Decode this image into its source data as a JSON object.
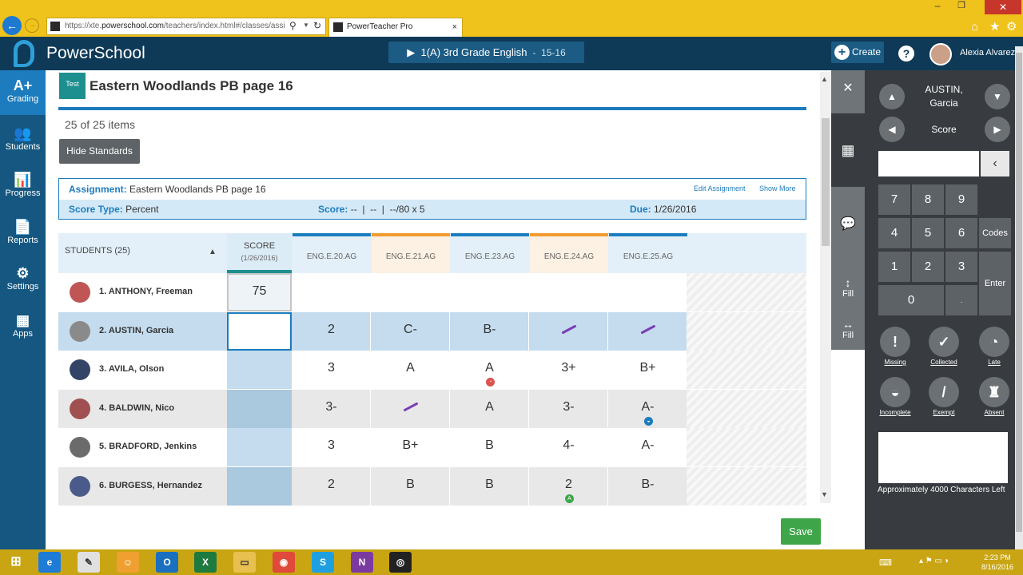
{
  "browser": {
    "url_prefix": "https://xte.",
    "url_domain": "powerschool.com",
    "url_path": "/teachers/index.html#/classes/assi",
    "tab_title": "PowerTeacher Pro",
    "tab_close": "×",
    "win_min": "–",
    "win_max": "❐",
    "win_close": "✕"
  },
  "header": {
    "brand": "PowerSchool",
    "class_name": "1(A) 3rd Grade English",
    "term": "15-16",
    "create_label": "Create",
    "help_label": "?",
    "user_name": "Alexia Alvarez"
  },
  "nav": [
    {
      "label": "Grading",
      "icon": "A+"
    },
    {
      "label": "Students",
      "icon": "👥"
    },
    {
      "label": "Progress",
      "icon": "📊"
    },
    {
      "label": "Reports",
      "icon": "📄"
    },
    {
      "label": "Settings",
      "icon": "⚙"
    },
    {
      "label": "Apps",
      "icon": "▦"
    }
  ],
  "assignment": {
    "badge": "Test",
    "title": "Eastern Woodlands PB page 16",
    "item_count": "25 of 25 items",
    "hide_standards": "Hide Standards",
    "assignment_label": "Assignment:",
    "assignment_value": "Eastern Woodlands PB page 16",
    "edit_link": "Edit Assignment",
    "show_more": "Show More",
    "score_type_label": "Score Type:",
    "score_type_value": "Percent",
    "score_label": "Score:",
    "score_value": "--  |  --  |  --/80 x 5",
    "due_label": "Due:",
    "due_value": "1/26/2016"
  },
  "table": {
    "students_header": "STUDENTS (25)",
    "score_header": "SCORE",
    "score_date": "(1/26/2016)",
    "standards": [
      {
        "code": "ENG.E.20.AG",
        "color": "#1c7cbe"
      },
      {
        "code": "ENG.E.21.AG",
        "color": "#f29b30"
      },
      {
        "code": "ENG.E.23.AG",
        "color": "#1c7cbe"
      },
      {
        "code": "ENG.E.24.AG",
        "color": "#f29b30"
      },
      {
        "code": "ENG.E.25.AG",
        "color": "#1c7cbe"
      }
    ],
    "rows": [
      {
        "name": "1. ANTHONY, Freeman",
        "score": "75",
        "grades": [
          "",
          "",
          "",
          "",
          ""
        ]
      },
      {
        "name": "2. AUSTIN, Garcia",
        "score": "",
        "grades": [
          "2",
          "C-",
          "B-",
          "/",
          "/"
        ]
      },
      {
        "name": "3. AVILA, Olson",
        "score": "",
        "grades": [
          "3",
          "A",
          "A",
          "3+",
          "B+"
        ]
      },
      {
        "name": "4. BALDWIN, Nico",
        "score": "",
        "grades": [
          "3-",
          "/",
          "A",
          "3-",
          "A-"
        ]
      },
      {
        "name": "5. BRADFORD, Jenkins",
        "score": "",
        "grades": [
          "3",
          "B+",
          "B",
          "4-",
          "A-"
        ]
      },
      {
        "name": "6. BURGESS, Hernandez",
        "score": "",
        "grades": [
          "2",
          "B",
          "B",
          "2",
          "B-"
        ]
      }
    ]
  },
  "tools": {
    "close": "✕",
    "fill_label": "Fill"
  },
  "panel": {
    "student_last": "AUSTIN,",
    "student_first": "Garcia",
    "field_label": "Score",
    "keys": [
      "7",
      "8",
      "9",
      "4",
      "5",
      "6",
      "1",
      "2",
      "3",
      "0",
      "."
    ],
    "codes_label": "Codes",
    "enter_label": "Enter",
    "backspace": "‹",
    "codes": [
      {
        "label": "Missing",
        "icon": "!"
      },
      {
        "label": "Collected",
        "icon": "✓"
      },
      {
        "label": "Late",
        "icon": "◔"
      },
      {
        "label": "Incomplete",
        "icon": "◒"
      },
      {
        "label": "Exempt",
        "icon": "/"
      },
      {
        "label": "Absent",
        "icon": "♜"
      }
    ],
    "chars_left": "Approximately 4000 Characters Left",
    "save_label": "Save"
  },
  "taskbar": {
    "time": "2:23 PM",
    "date": "8/16/2016"
  }
}
